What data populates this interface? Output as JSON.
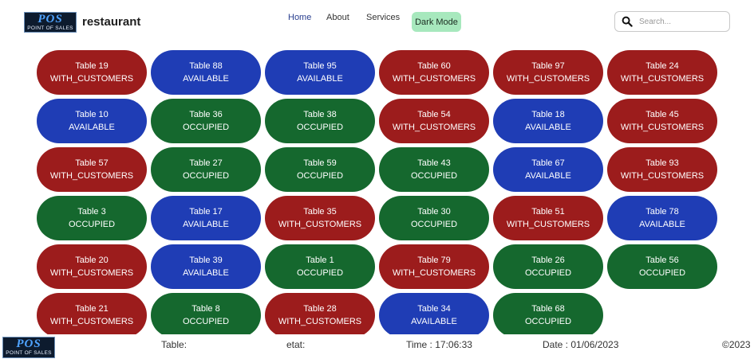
{
  "header": {
    "logo": {
      "big": "POS",
      "small": "POINT OF SALES"
    },
    "brand": "restaurant",
    "nav": [
      {
        "label": "Home",
        "active": true
      },
      {
        "label": "About",
        "active": false
      },
      {
        "label": "Services",
        "active": false
      }
    ],
    "dark_mode_label": "Dark Mode",
    "search": {
      "placeholder": "Search...",
      "value": "",
      "icon": "search-icon"
    }
  },
  "status_colors": {
    "WITH_CUSTOMERS": "#9c1c1c",
    "AVAILABLE": "#1f3db5",
    "OCCUPIED": "#15682e"
  },
  "tables": [
    {
      "name": "Table 19",
      "status": "WITH_CUSTOMERS"
    },
    {
      "name": "Table 88",
      "status": "AVAILABLE"
    },
    {
      "name": "Table 95",
      "status": "AVAILABLE"
    },
    {
      "name": "Table 60",
      "status": "WITH_CUSTOMERS"
    },
    {
      "name": "Table 97",
      "status": "WITH_CUSTOMERS"
    },
    {
      "name": "Table 24",
      "status": "WITH_CUSTOMERS"
    },
    {
      "name": "Table 10",
      "status": "AVAILABLE"
    },
    {
      "name": "Table 36",
      "status": "OCCUPIED"
    },
    {
      "name": "Table 38",
      "status": "OCCUPIED"
    },
    {
      "name": "Table 54",
      "status": "WITH_CUSTOMERS"
    },
    {
      "name": "Table 18",
      "status": "AVAILABLE"
    },
    {
      "name": "Table 45",
      "status": "WITH_CUSTOMERS"
    },
    {
      "name": "Table 57",
      "status": "WITH_CUSTOMERS"
    },
    {
      "name": "Table 27",
      "status": "OCCUPIED"
    },
    {
      "name": "Table 59",
      "status": "OCCUPIED"
    },
    {
      "name": "Table 43",
      "status": "OCCUPIED"
    },
    {
      "name": "Table 67",
      "status": "AVAILABLE"
    },
    {
      "name": "Table 93",
      "status": "WITH_CUSTOMERS"
    },
    {
      "name": "Table 3",
      "status": "OCCUPIED"
    },
    {
      "name": "Table 17",
      "status": "AVAILABLE"
    },
    {
      "name": "Table 35",
      "status": "WITH_CUSTOMERS"
    },
    {
      "name": "Table 30",
      "status": "OCCUPIED"
    },
    {
      "name": "Table 51",
      "status": "WITH_CUSTOMERS"
    },
    {
      "name": "Table 78",
      "status": "AVAILABLE"
    },
    {
      "name": "Table 20",
      "status": "WITH_CUSTOMERS"
    },
    {
      "name": "Table 39",
      "status": "AVAILABLE"
    },
    {
      "name": "Table 1",
      "status": "OCCUPIED"
    },
    {
      "name": "Table 79",
      "status": "WITH_CUSTOMERS"
    },
    {
      "name": "Table 26",
      "status": "OCCUPIED"
    },
    {
      "name": "Table 56",
      "status": "OCCUPIED"
    },
    {
      "name": "Table 21",
      "status": "WITH_CUSTOMERS"
    },
    {
      "name": "Table 8",
      "status": "OCCUPIED"
    },
    {
      "name": "Table 28",
      "status": "WITH_CUSTOMERS"
    },
    {
      "name": "Table 34",
      "status": "AVAILABLE"
    },
    {
      "name": "Table 68",
      "status": "OCCUPIED"
    }
  ],
  "footer": {
    "logo": {
      "big": "POS",
      "small": "POINT OF SALES"
    },
    "table_label": "Table:",
    "etat_label": "etat:",
    "time": "Time : 17:06:33",
    "date": "Date : 01/06/2023",
    "copyright": "©2023"
  }
}
